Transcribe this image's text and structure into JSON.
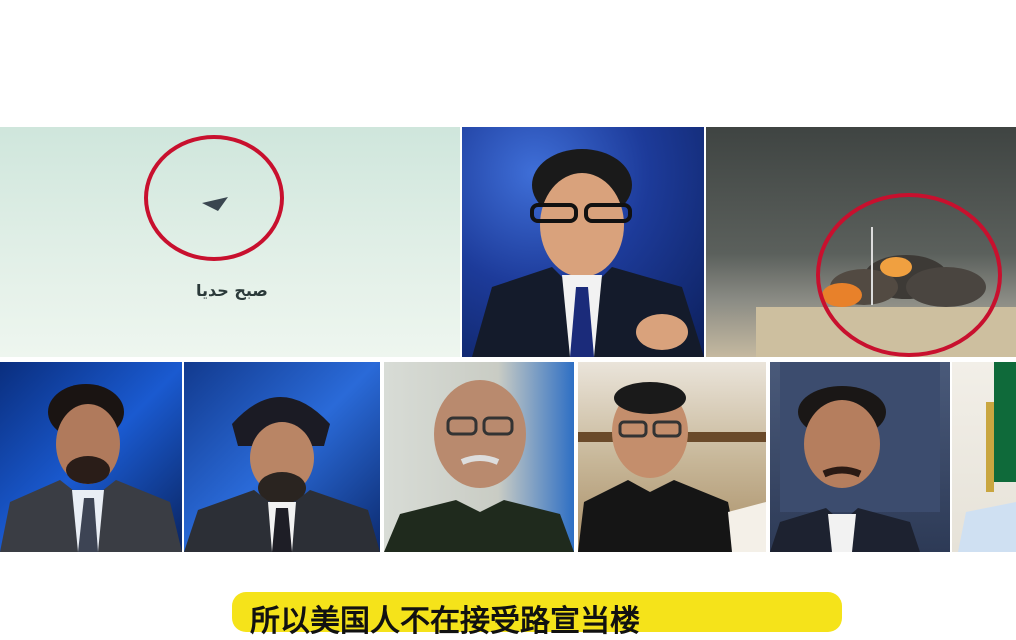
{
  "top_tiles": {
    "left_overlay_text": "ﺻﺒﺢ ﺣﺪﻳﺎ"
  },
  "caption": {
    "text": "所以美国人不在接受路宣当楼"
  },
  "colors": {
    "highlight_circle": "#c8102e",
    "caption_bg": "#f5e31a",
    "studio_blue": "#0c2a74"
  }
}
